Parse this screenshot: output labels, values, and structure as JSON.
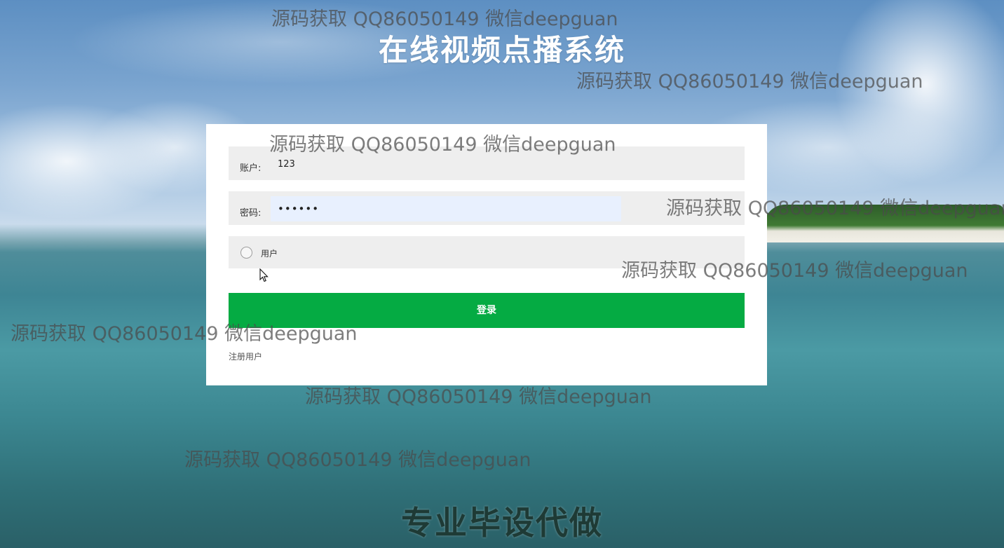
{
  "header": {
    "title": "在线视频点播系统"
  },
  "login_form": {
    "account_label": "账户:",
    "account_value": "123",
    "password_label": "密码:",
    "password_value": "••••••",
    "role_option": "用户",
    "login_button": "登录",
    "register_link": "注册用户"
  },
  "watermarks": [
    "源码获取 QQ86050149 微信deepguan",
    "源码获取 QQ86050149 微信deepguan",
    "源码获取 QQ86050149 微信deepguan",
    "源码获取 QQ86050149 微信deepguan",
    "源码获取 QQ86050149 微信deepguan",
    "源码获取 QQ86050149 微信deepguan",
    "源码获取 QQ86050149 微信deepguan",
    "源码获取 QQ86050149 微信deepguan"
  ],
  "footer": {
    "banner": "专业毕设代做"
  },
  "colors": {
    "login_button": "#05ab43",
    "card_background": "#ffffff",
    "field_background": "#eeeeee",
    "autofill_background": "#e8f0fe"
  }
}
